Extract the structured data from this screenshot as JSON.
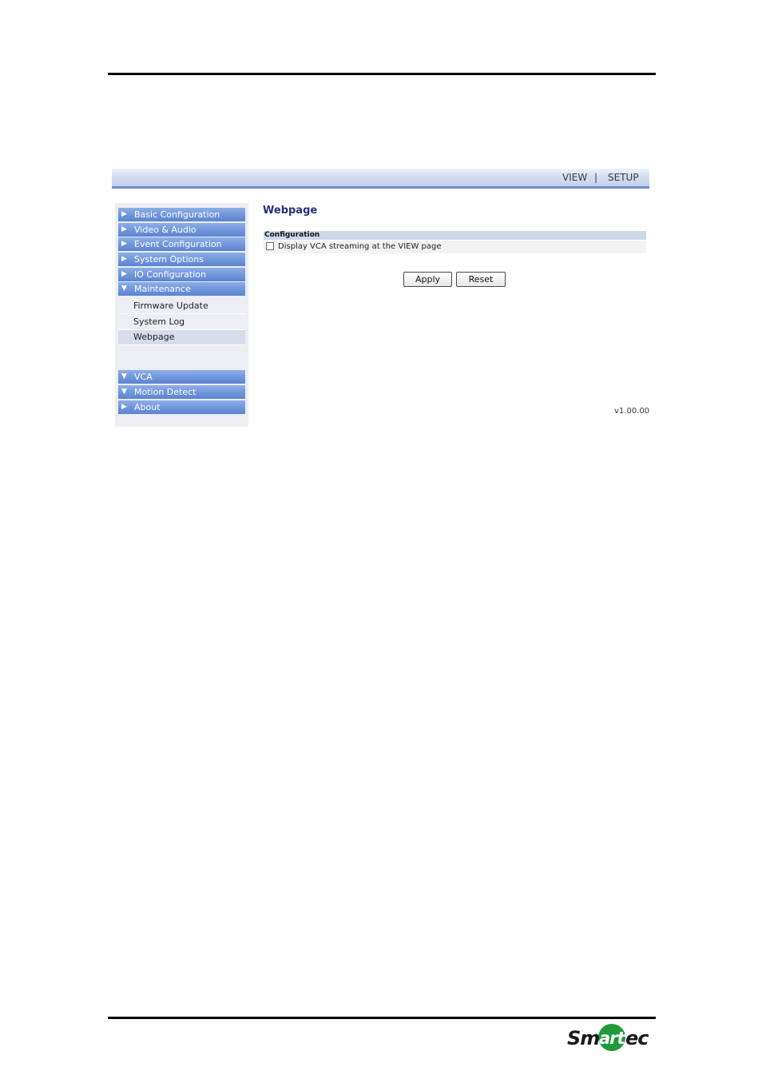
{
  "topbar": {
    "view_label": "VIEW",
    "separator": "|",
    "setup_label": "SETUP"
  },
  "sidebar": {
    "menu": [
      {
        "label": "Basic Configuration",
        "arrow": "▶",
        "expanded": false
      },
      {
        "label": "Video & Audio",
        "arrow": "▶",
        "expanded": false
      },
      {
        "label": "Event Configuration",
        "arrow": "▶",
        "expanded": false
      },
      {
        "label": "System Options",
        "arrow": "▶",
        "expanded": false
      },
      {
        "label": "IO Configuration",
        "arrow": "▶",
        "expanded": false
      },
      {
        "label": "Maintenance",
        "arrow": "▼",
        "expanded": true
      }
    ],
    "submenu": [
      {
        "label": "Firmware Update",
        "active": false
      },
      {
        "label": "System Log",
        "active": false
      },
      {
        "label": "Webpage",
        "active": true
      }
    ],
    "menu2": [
      {
        "label": "VCA",
        "arrow": "▼"
      },
      {
        "label": "Motion Detect",
        "arrow": "▼"
      },
      {
        "label": "About",
        "arrow": "▶"
      }
    ]
  },
  "main": {
    "title": "Webpage",
    "section_header": "Configuration",
    "checkbox_label": "Display VCA streaming at the VIEW page",
    "checkbox_checked": false,
    "apply_label": "Apply",
    "reset_label": "Reset",
    "version": "v1.00.00"
  },
  "logo": {
    "text_left": "Sm",
    "text_mid": "art",
    "text_right": "ec",
    "brand_color": "#1f9a3c"
  },
  "colors": {
    "menu_blue": "#6f95db",
    "title_navy": "#2a2f7a",
    "header_bg": "#cfd8ea"
  }
}
